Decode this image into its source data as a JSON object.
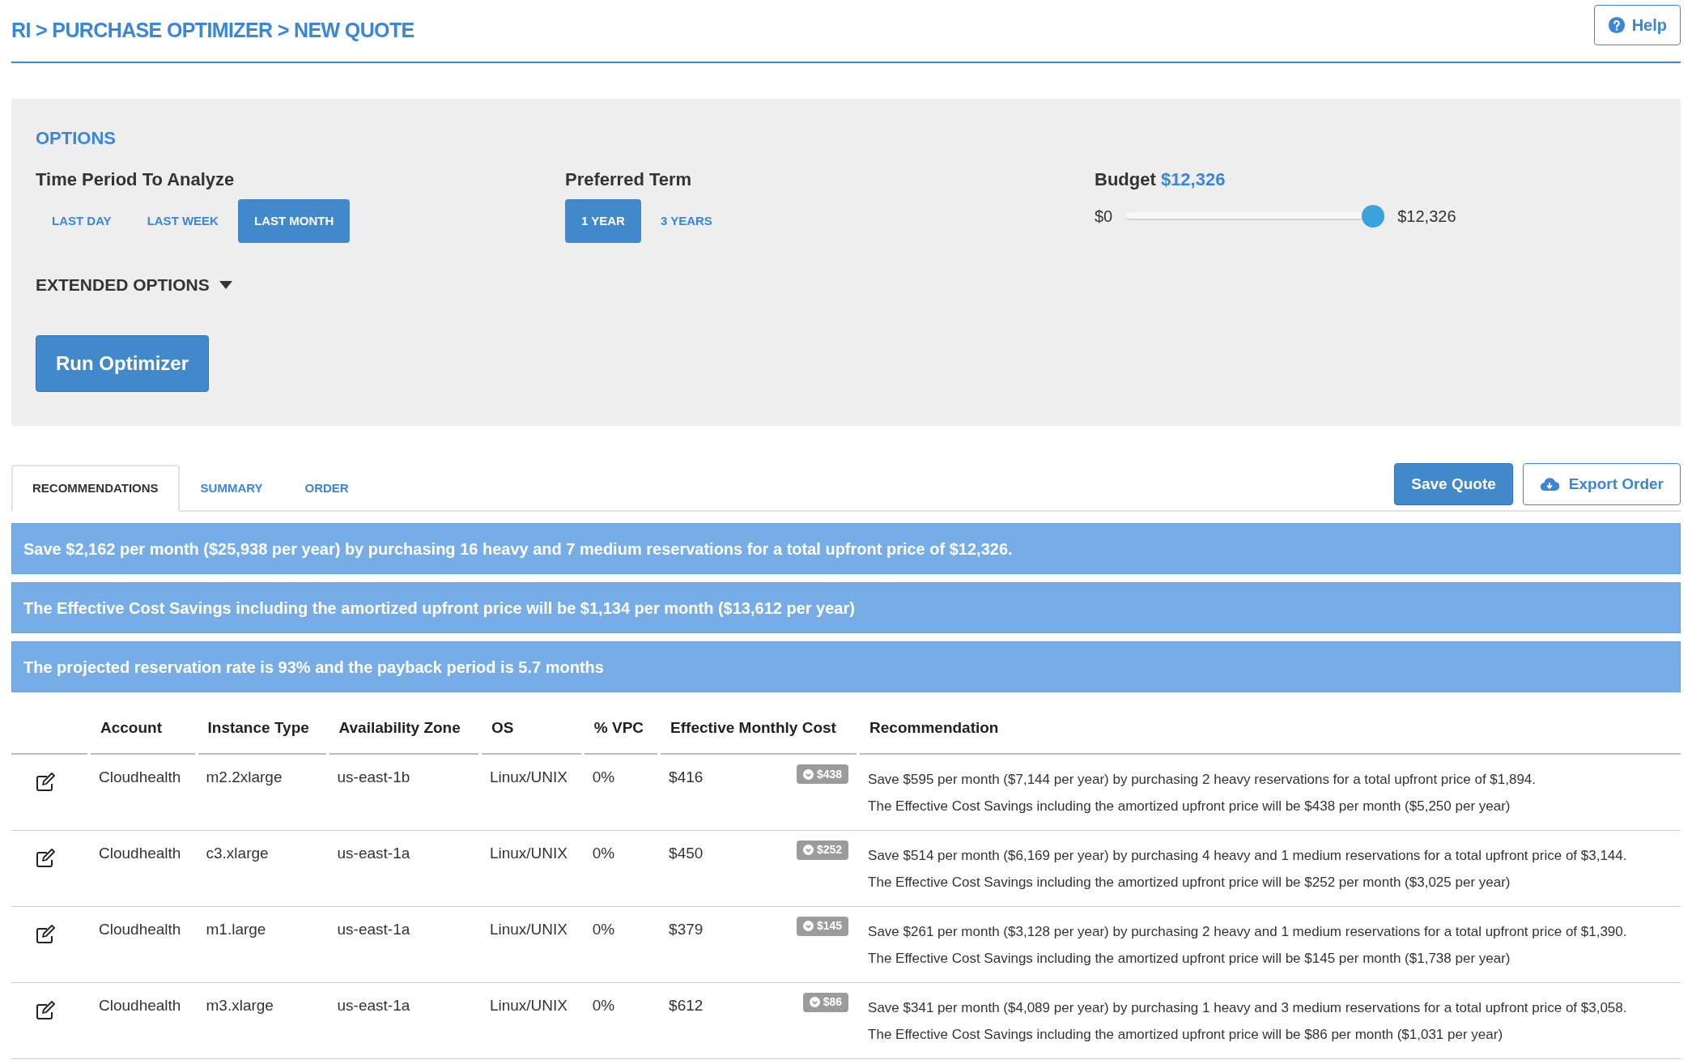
{
  "breadcrumb": "RI > PURCHASE OPTIMIZER > NEW QUOTE",
  "help_button": "Help",
  "options": {
    "title": "OPTIONS",
    "time_period": {
      "label": "Time Period To Analyze",
      "choices": [
        {
          "label": "LAST DAY",
          "selected": false
        },
        {
          "label": "LAST WEEK",
          "selected": false
        },
        {
          "label": "LAST MONTH",
          "selected": true
        }
      ]
    },
    "preferred_term": {
      "label": "Preferred Term",
      "choices": [
        {
          "label": "1 YEAR",
          "selected": true
        },
        {
          "label": "3 YEARS",
          "selected": false
        }
      ]
    },
    "budget": {
      "label": "Budget",
      "value": "$12,326",
      "min": "$0",
      "max": "$12,326",
      "level": 1
    },
    "extended_options": {
      "label": "EXTENDED OPTIONS",
      "expanded": false
    },
    "run_button": "Run Optimizer"
  },
  "tabs": [
    {
      "label": "RECOMMENDATIONS",
      "selected": true
    },
    {
      "label": "SUMMARY",
      "selected": false
    },
    {
      "label": "ORDER",
      "selected": false
    }
  ],
  "actions": {
    "save": "Save Quote",
    "export": "Export Order"
  },
  "banners": [
    "Save $2,162 per month ($25,938 per year) by purchasing 16 heavy and 7 medium reservations for a total upfront price of $12,326.",
    "The Effective Cost Savings including the amortized upfront price will be $1,134 per month ($13,612 per year)",
    "The projected reservation rate is 93% and the payback period is 5.7 months"
  ],
  "table": {
    "columns": [
      "Account",
      "Instance Type",
      "Availability Zone",
      "OS",
      "% VPC",
      "Effective Monthly Cost",
      "Recommendation"
    ],
    "rows": [
      {
        "account": "Cloudhealth",
        "instance_type": "m2.2xlarge",
        "zone": "us-east-1b",
        "os": "Linux/UNIX",
        "vpc": "0%",
        "cost": "$416",
        "savings_badge": "$438",
        "recommendation": [
          "Save $595 per month ($7,144 per year) by purchasing 2 heavy reservations for a total upfront price of $1,894.",
          "The Effective Cost Savings including the amortized upfront price will be $438 per month ($5,250 per year)"
        ]
      },
      {
        "account": "Cloudhealth",
        "instance_type": "c3.xlarge",
        "zone": "us-east-1a",
        "os": "Linux/UNIX",
        "vpc": "0%",
        "cost": "$450",
        "savings_badge": "$252",
        "recommendation": [
          "Save $514 per month ($6,169 per year) by purchasing 4 heavy and 1 medium reservations for a total upfront price of $3,144.",
          "The Effective Cost Savings including the amortized upfront price will be $252 per month ($3,025 per year)"
        ]
      },
      {
        "account": "Cloudhealth",
        "instance_type": "m1.large",
        "zone": "us-east-1a",
        "os": "Linux/UNIX",
        "vpc": "0%",
        "cost": "$379",
        "savings_badge": "$145",
        "recommendation": [
          "Save $261 per month ($3,128 per year) by purchasing 2 heavy and 1 medium reservations for a total upfront price of $1,390.",
          "The Effective Cost Savings including the amortized upfront price will be $145 per month ($1,738 per year)"
        ]
      },
      {
        "account": "Cloudhealth",
        "instance_type": "m3.xlarge",
        "zone": "us-east-1a",
        "os": "Linux/UNIX",
        "vpc": "0%",
        "cost": "$612",
        "savings_badge": "$86",
        "recommendation": [
          "Save $341 per month ($4,089 per year) by purchasing 1 heavy and 3 medium reservations for a total upfront price of $3,058.",
          "The Effective Cost Savings including the amortized upfront price will be $86 per month ($1,031 per year)"
        ]
      }
    ]
  }
}
